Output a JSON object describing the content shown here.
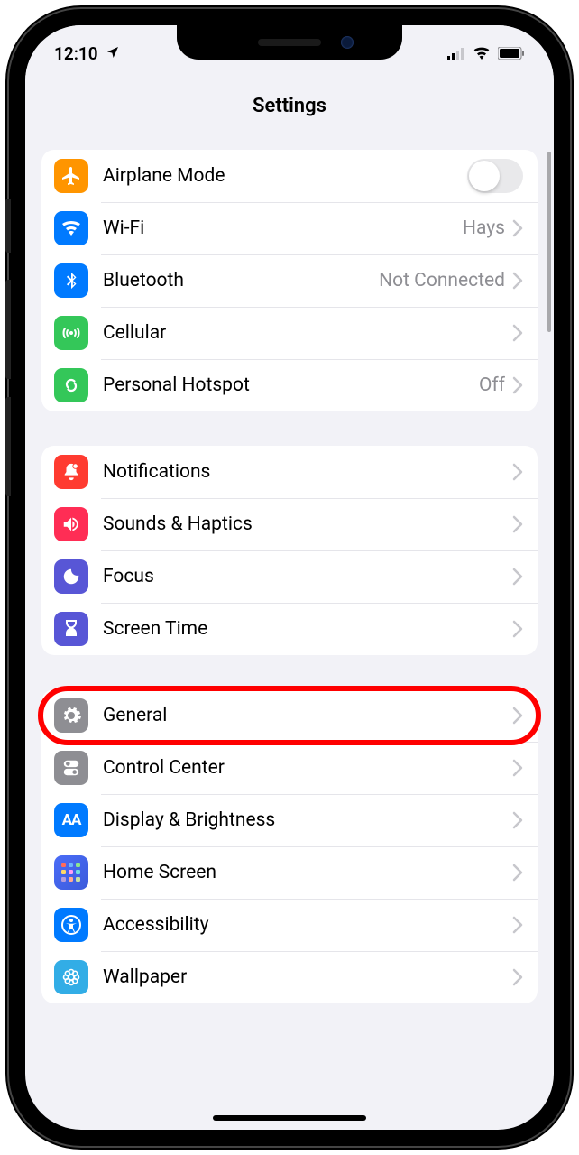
{
  "status_bar": {
    "time": "12:10",
    "location_icon": "location-arrow",
    "cellular": "2-bars",
    "wifi": "full",
    "battery": "full"
  },
  "header": {
    "title": "Settings"
  },
  "groups": [
    {
      "rows": [
        {
          "id": "airplane",
          "label": "Airplane Mode",
          "icon": "airplane-icon",
          "icon_bg": "bg-orange",
          "control": "toggle",
          "toggle_on": false
        },
        {
          "id": "wifi",
          "label": "Wi-Fi",
          "icon": "wifi-icon",
          "icon_bg": "bg-blue",
          "value": "Hays",
          "control": "disclosure"
        },
        {
          "id": "bluetooth",
          "label": "Bluetooth",
          "icon": "bluetooth-icon",
          "icon_bg": "bg-blue",
          "value": "Not Connected",
          "control": "disclosure"
        },
        {
          "id": "cellular",
          "label": "Cellular",
          "icon": "cellular-icon",
          "icon_bg": "bg-green",
          "control": "disclosure"
        },
        {
          "id": "hotspot",
          "label": "Personal Hotspot",
          "icon": "hotspot-icon",
          "icon_bg": "bg-green",
          "value": "Off",
          "control": "disclosure"
        }
      ]
    },
    {
      "rows": [
        {
          "id": "notifications",
          "label": "Notifications",
          "icon": "notifications-icon",
          "icon_bg": "bg-red",
          "control": "disclosure"
        },
        {
          "id": "sounds",
          "label": "Sounds & Haptics",
          "icon": "sounds-icon",
          "icon_bg": "bg-pink",
          "control": "disclosure"
        },
        {
          "id": "focus",
          "label": "Focus",
          "icon": "focus-icon",
          "icon_bg": "bg-purple",
          "control": "disclosure"
        },
        {
          "id": "screentime",
          "label": "Screen Time",
          "icon": "screentime-icon",
          "icon_bg": "bg-purple",
          "control": "disclosure"
        }
      ]
    },
    {
      "rows": [
        {
          "id": "general",
          "label": "General",
          "icon": "general-icon",
          "icon_bg": "bg-gray",
          "control": "disclosure",
          "highlighted": true
        },
        {
          "id": "controlcenter",
          "label": "Control Center",
          "icon": "controlcenter-icon",
          "icon_bg": "bg-gray",
          "control": "disclosure"
        },
        {
          "id": "display",
          "label": "Display & Brightness",
          "icon": "display-icon",
          "icon_bg": "bg-blue",
          "control": "disclosure"
        },
        {
          "id": "homescreen",
          "label": "Home Screen",
          "icon": "homescreen-icon",
          "icon_bg": "bg-home",
          "control": "disclosure"
        },
        {
          "id": "accessibility",
          "label": "Accessibility",
          "icon": "accessibility-icon",
          "icon_bg": "bg-blue",
          "control": "disclosure"
        },
        {
          "id": "wallpaper",
          "label": "Wallpaper",
          "icon": "wallpaper-icon",
          "icon_bg": "bg-cyan",
          "control": "disclosure"
        }
      ]
    }
  ]
}
